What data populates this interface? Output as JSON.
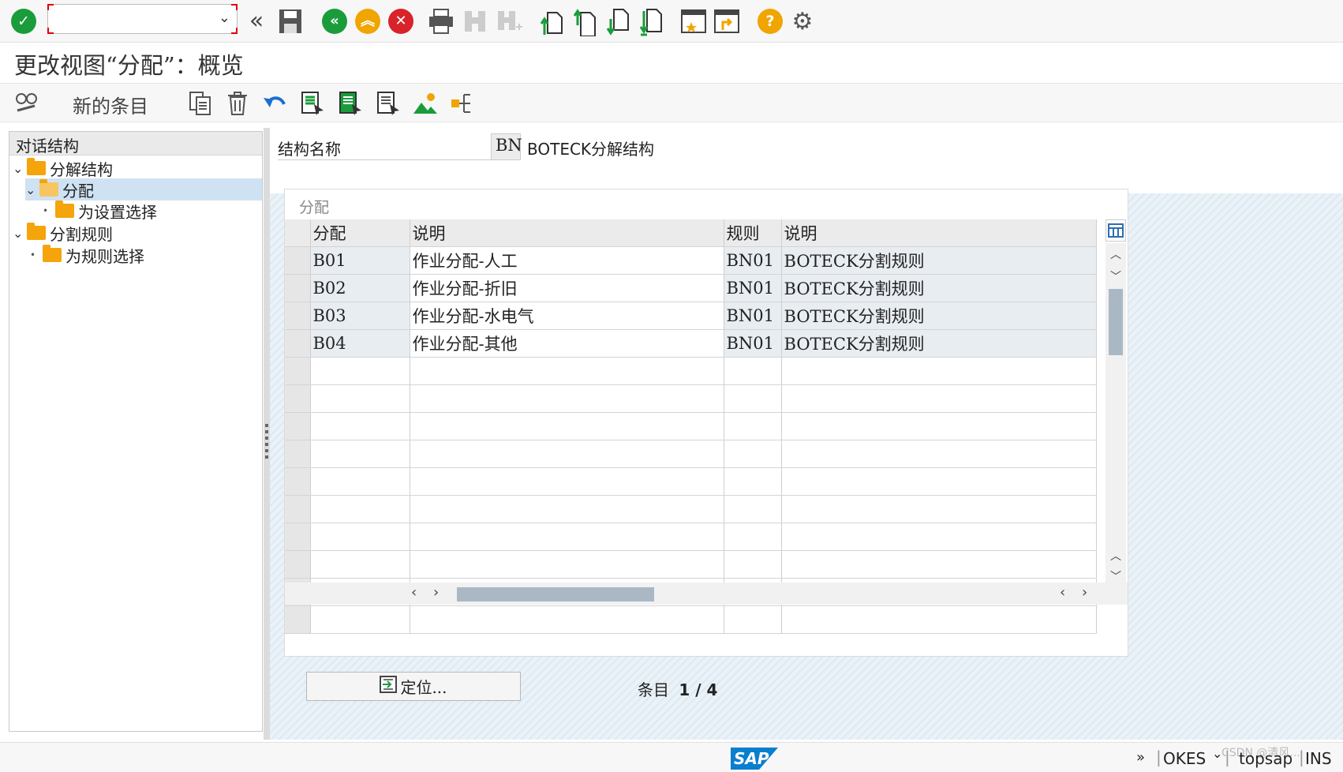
{
  "toolbar": {
    "command_field_value": "",
    "icons": [
      "enter-icon",
      "command-field",
      "back-arrows-icon",
      "save-icon",
      "back-icon",
      "exit-icon",
      "cancel-icon",
      "print-icon",
      "find-icon",
      "find-next-icon",
      "first-page-icon",
      "previous-page-icon",
      "next-page-icon",
      "last-page-icon",
      "create-session-icon",
      "shortcut-icon",
      "help-icon",
      "settings-icon"
    ]
  },
  "title": "更改视图“分配”：概览",
  "app_toolbar": {
    "new_entries_label": "新的条目",
    "icons": [
      "display-change-icon",
      "copy-icon",
      "delete-icon",
      "undo-icon",
      "select-all-icon",
      "select-block-icon",
      "deselect-all-icon",
      "bc-set-icon",
      "where-used-icon"
    ]
  },
  "tree": {
    "header": "对话结构",
    "nodes": [
      {
        "label": "分解结构",
        "level": 0,
        "expanded": true
      },
      {
        "label": "分配",
        "level": 1,
        "expanded": true,
        "selected": true
      },
      {
        "label": "为设置选择",
        "level": 2
      },
      {
        "label": "分割规则",
        "level": 0,
        "expanded": true
      },
      {
        "label": "为规则选择",
        "level": 1
      }
    ]
  },
  "header_field": {
    "label": "结构名称",
    "value": "BN",
    "description": "BOTECK分解结构"
  },
  "table": {
    "title": "分配",
    "columns": [
      "分配",
      "说明",
      "规则",
      "说明"
    ],
    "rows": [
      [
        "B01",
        "作业分配-人工",
        "BN01",
        "BOTECK分割规则"
      ],
      [
        "B02",
        "作业分配-折旧",
        "BN01",
        "BOTECK分割规则"
      ],
      [
        "B03",
        "作业分配-水电气",
        "BN01",
        "BOTECK分割规则"
      ],
      [
        "B04",
        "作业分配-其他",
        "BN01",
        "BOTECK分割规则"
      ]
    ],
    "empty_rows": 10
  },
  "position_button": "定位...",
  "entry_label": "条目",
  "entry_value": "1 / 4",
  "status_bar": {
    "system": "OKES",
    "server": "topsap",
    "mode": "INS",
    "watermark": "CSDN @清风..."
  },
  "colors": {
    "enter": "#1a9c3a",
    "back": "#1a9c3a",
    "exit": "#f0a500",
    "cancel": "#d8232a",
    "help": "#f0a500",
    "folder": "#f5a40b",
    "selected_node": "#cfe2f3",
    "sap_blue": "#0a7ecf"
  }
}
